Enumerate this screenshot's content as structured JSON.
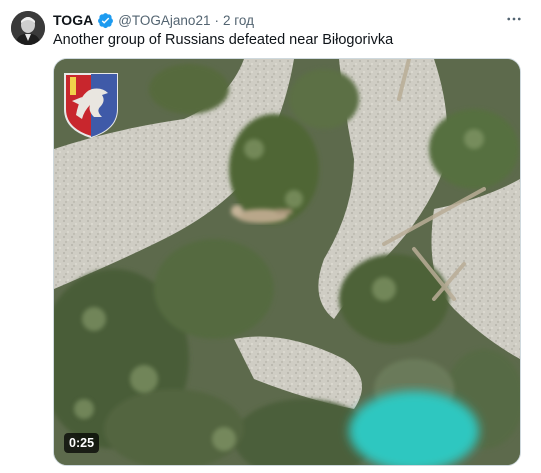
{
  "tweet": {
    "author_name": "TOGA",
    "handle": "@TOGAjano21",
    "separator": "·",
    "time": "2 год",
    "text": "Another group of Russians defeated near Biłogorivka"
  },
  "media": {
    "type": "video",
    "duration": "0:25"
  },
  "icons": {
    "verified": "verified-badge-icon",
    "more": "more-options-icon",
    "emblem": "military-unit-emblem-icon"
  },
  "colors": {
    "verified_blue": "#1d9bf0",
    "text_primary": "#0f1419",
    "text_secondary": "#536471",
    "emblem_red": "#c8262d",
    "emblem_blue": "#3f5aa8"
  }
}
